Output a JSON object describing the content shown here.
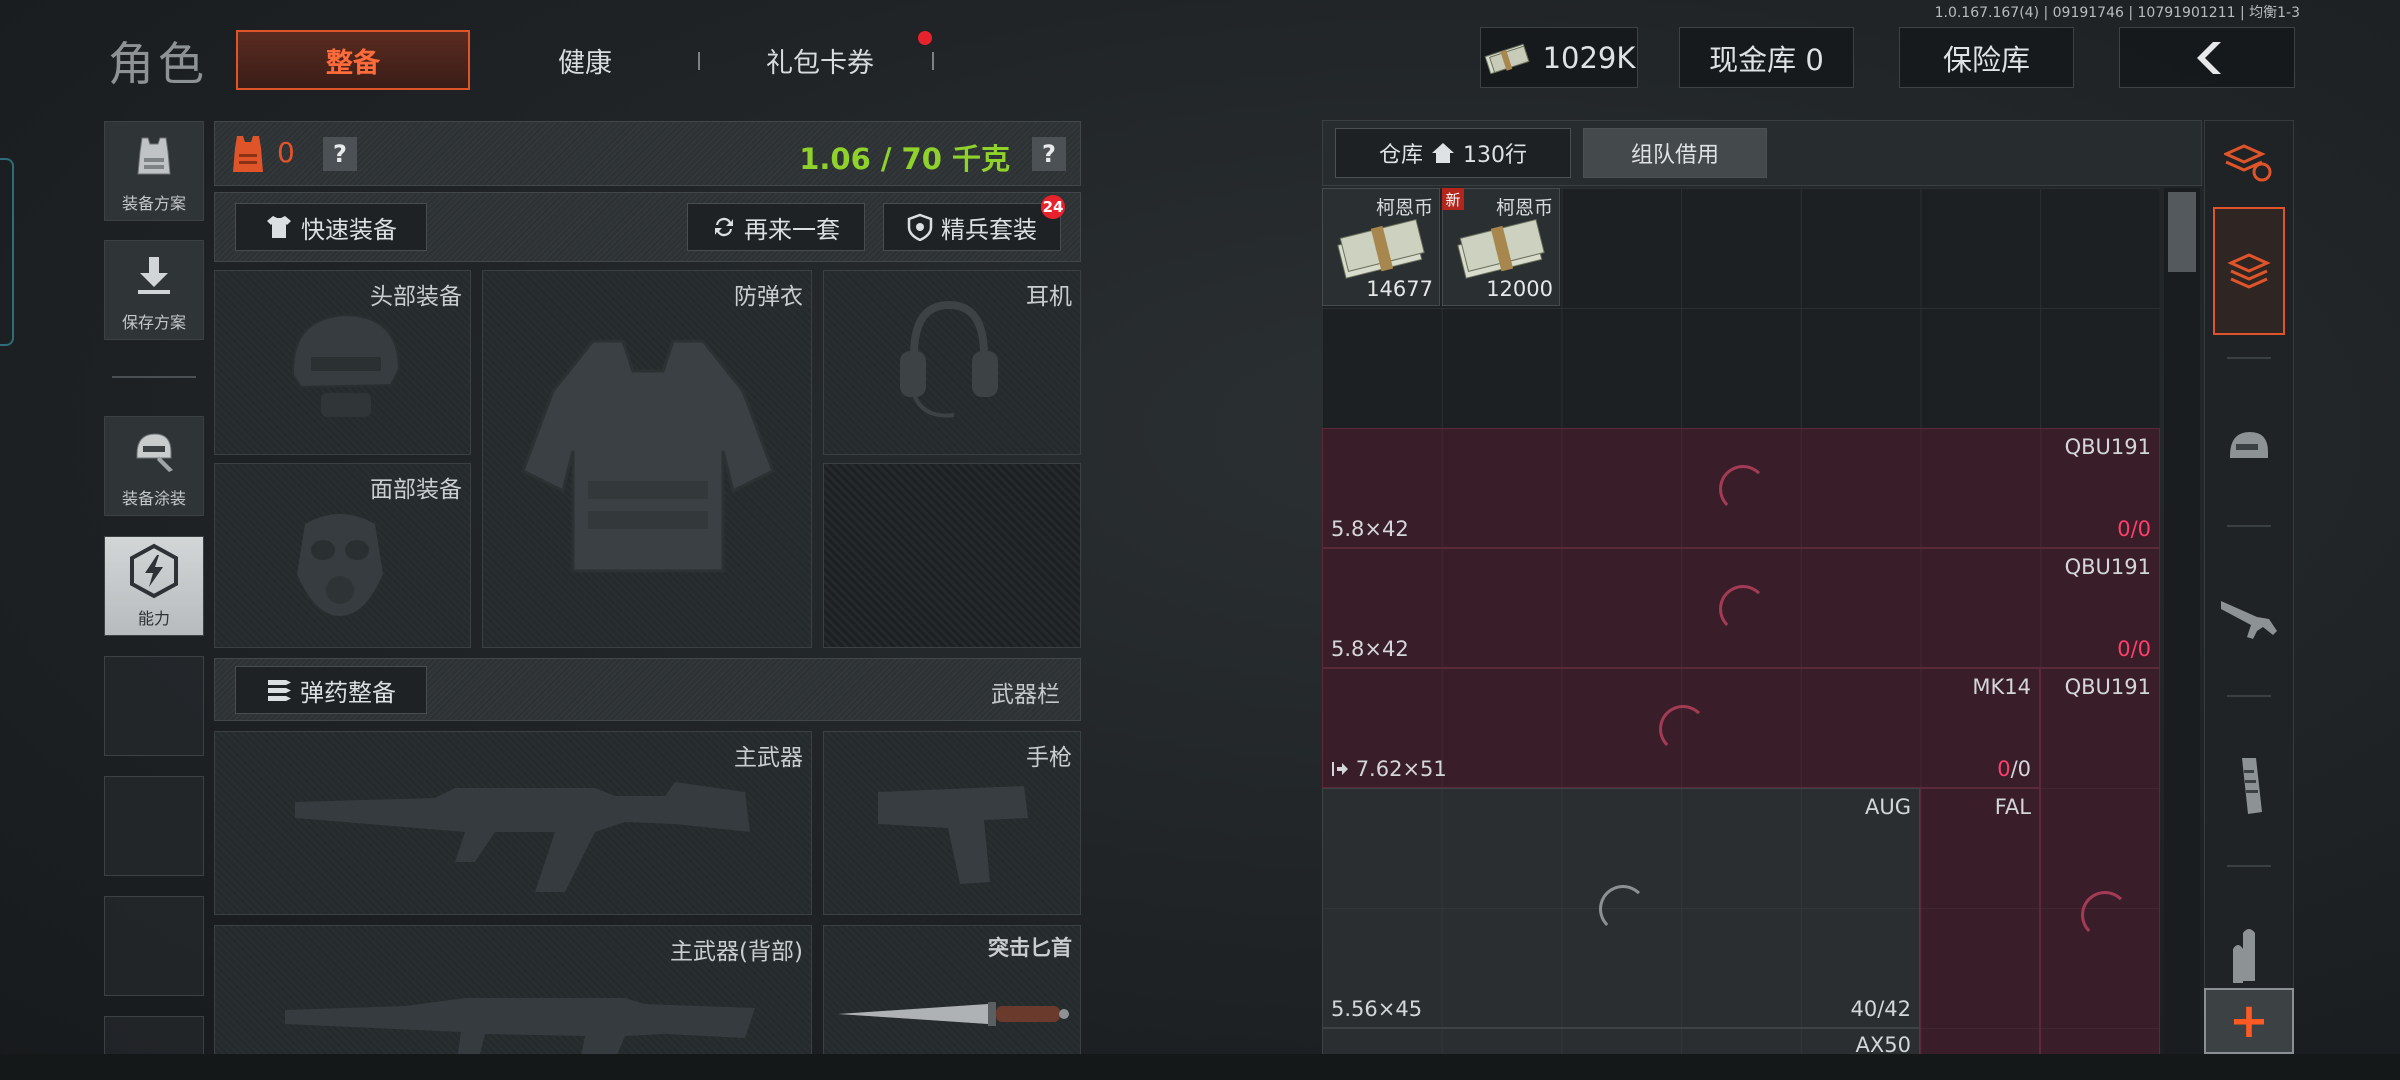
{
  "version": "1.0.167.167(4) | 09191746 | 10791901211 | 均衡1-3",
  "header": {
    "title": "角色",
    "tabs": [
      {
        "label": "整备",
        "active": true
      },
      {
        "label": "健康",
        "active": false
      },
      {
        "label": "礼包卡券",
        "active": false,
        "has_notification": true
      }
    ],
    "currency": "1029K",
    "cash_vault": "现金库 0",
    "insurance": "保险库",
    "back_icon": "chevron-left-icon"
  },
  "sidebar": {
    "items": [
      {
        "label": "装备方案",
        "icon": "vest-icon"
      },
      {
        "label": "保存方案",
        "icon": "download-icon"
      },
      {
        "label": "装备涂装",
        "icon": "helmet-paint-icon"
      },
      {
        "label": "能力",
        "icon": "ability-hex-icon",
        "selected": true
      }
    ]
  },
  "equipment": {
    "armor_count": "0",
    "weight": "1.06 / 70 千克",
    "help": "?",
    "quick_equip": "快速装备",
    "retry_set": "再来一套",
    "elite_set": "精兵套装",
    "elite_badge": "24",
    "slots": {
      "head": "头部装备",
      "vest": "防弹衣",
      "headset": "耳机",
      "face": "面部装备"
    },
    "ammo_button": "弹药整备",
    "weapon_bar": "武器栏",
    "weapons": {
      "primary": "主武器",
      "pistol": "手枪",
      "primary_back": "主武器(背部)",
      "knife": "突击匕首"
    }
  },
  "warehouse": {
    "tab_label": "仓库",
    "rows": "130行",
    "team_borrow": "组队借用",
    "money_items": [
      {
        "name": "柯恩币",
        "count": "14677",
        "is_new": true,
        "new_label": "新"
      },
      {
        "name": "柯恩币",
        "count": "12000",
        "is_new": false
      }
    ],
    "weapon_items": [
      {
        "name": "QBU191",
        "caliber": "5.8×42",
        "ammo_cur": "0",
        "ammo_max": "/0"
      },
      {
        "name": "QBU191",
        "caliber": "5.8×42",
        "ammo_cur": "0",
        "ammo_max": "/0"
      },
      {
        "name": "MK14",
        "caliber": "7.62×51",
        "ammo_cur": "0",
        "ammo_max": "/0"
      },
      {
        "name": "QBU191"
      },
      {
        "name": "AUG",
        "caliber": "5.56×45",
        "ammo": "40/42"
      },
      {
        "name": "FAL"
      },
      {
        "name": "AX50"
      }
    ]
  },
  "rail": {
    "items": [
      "layers-refresh-icon",
      "stack-icon",
      "helmet-icon",
      "rifle-icon",
      "magazine-icon",
      "bullet-icon"
    ],
    "add": "+"
  },
  "colors": {
    "accent": "#e0542a",
    "weight_green": "#8fd22c",
    "ammo_red": "#ff3f6b"
  }
}
